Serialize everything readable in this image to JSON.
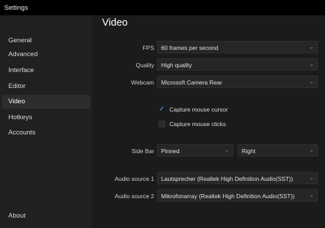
{
  "window": {
    "title": "Settings"
  },
  "sidebar": {
    "items": [
      {
        "label": "General"
      },
      {
        "label": "Advanced"
      },
      {
        "label": "Interface"
      },
      {
        "label": "Editor"
      },
      {
        "label": "Video",
        "active": true
      },
      {
        "label": "Hotkeys"
      },
      {
        "label": "Accounts"
      }
    ],
    "footer": {
      "label": "About"
    }
  },
  "video": {
    "heading": "Video",
    "fps": {
      "label": "FPS",
      "value": "60 frames per second"
    },
    "quality": {
      "label": "Quality",
      "value": "High quality"
    },
    "webcam": {
      "label": "Webcam",
      "value": "Microsoft Camera Rear"
    },
    "capture_cursor": {
      "label": "Capture mouse cursor",
      "checked": true
    },
    "capture_clicks": {
      "label": "Capture mouse clicks",
      "checked": false
    },
    "side_bar": {
      "label": "Side Bar",
      "mode": "Pinned",
      "position": "Right"
    },
    "audio1": {
      "label": "Audio source 1",
      "value": "Lautsprecher (Realtek High Definition Audio(SST))"
    },
    "audio2": {
      "label": "Audio source 2",
      "value": "Mikrofonarray (Realtek High Definition Audio(SST))"
    }
  },
  "icons": {
    "dropdown": "chevron-down-icon",
    "check": "checkmark-icon"
  },
  "colors": {
    "accent": "#5aa9f0",
    "sidebar_bg": "#202020",
    "content_bg": "#1b1b1b",
    "active_item": "#2d2d2d"
  }
}
